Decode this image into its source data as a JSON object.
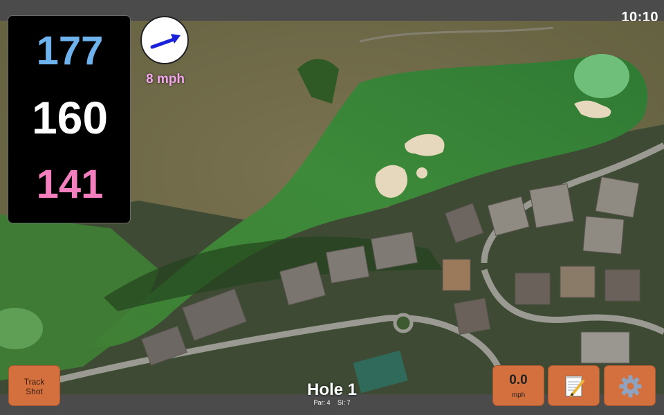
{
  "status_bar": {
    "time": "10:10"
  },
  "distances": {
    "back": {
      "value": "177",
      "color": "#6fb3ee"
    },
    "middle": {
      "value": "160",
      "color": "#ffffff"
    },
    "front": {
      "value": "141",
      "color": "#f47fbf"
    }
  },
  "wind": {
    "speed_label": "8 mph",
    "speed_color": "#f3a6ee",
    "arrow_color": "#1a22d9",
    "icon": "wind-direction-arrow-icon"
  },
  "buttons": {
    "track_shot_line1": "Track",
    "track_shot_line2": "Shot",
    "speed_value": "0.0",
    "speed_unit": "mph",
    "notes_icon": "notepad-pencil-icon",
    "settings_icon": "gear-icon",
    "button_color": "#d3703e"
  },
  "hole": {
    "title": "Hole 1",
    "par_label": "Par: 4",
    "si_label": "SI: 7"
  }
}
